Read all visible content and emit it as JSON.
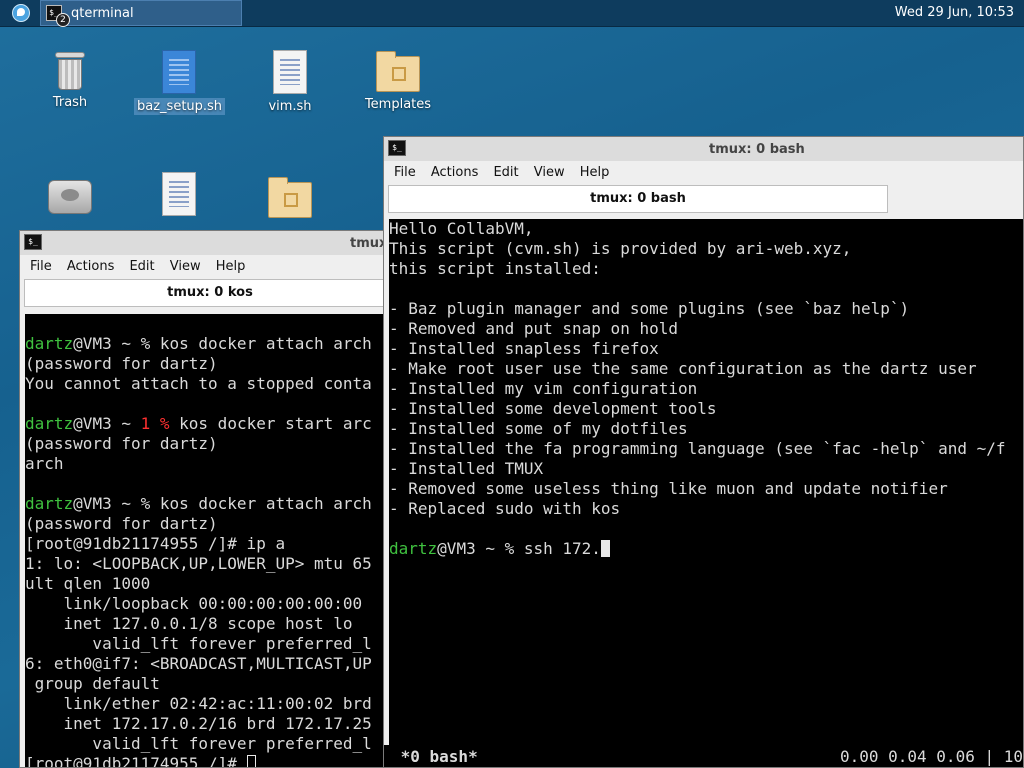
{
  "panel": {
    "task_label": "qterminal",
    "task_badge": "2",
    "clock": "Wed 29 Jun, 10:53"
  },
  "desktop": {
    "icons": [
      {
        "label": "Trash"
      },
      {
        "label": "baz_setup.sh"
      },
      {
        "label": "vim.sh"
      },
      {
        "label": "Templates"
      }
    ]
  },
  "win_left": {
    "title": "tmux",
    "menu": [
      "File",
      "Actions",
      "Edit",
      "View",
      "Help"
    ],
    "tab_label": "tmux: 0 kos",
    "lines": [
      {
        "segments": [
          {
            "t": ""
          }
        ]
      },
      {
        "segments": [
          {
            "t": "dartz",
            "c": "g"
          },
          {
            "t": "@VM3 ~ % kos docker attach arch"
          }
        ]
      },
      {
        "segments": [
          {
            "t": "(password for dartz)"
          }
        ]
      },
      {
        "segments": [
          {
            "t": "You cannot attach to a stopped conta"
          }
        ]
      },
      {
        "segments": [
          {
            "t": ""
          }
        ]
      },
      {
        "segments": [
          {
            "t": "dartz",
            "c": "g"
          },
          {
            "t": "@VM3 ~ "
          },
          {
            "t": "1 %",
            "c": "r"
          },
          {
            "t": " kos docker start arc"
          }
        ]
      },
      {
        "segments": [
          {
            "t": "(password for dartz)"
          }
        ]
      },
      {
        "segments": [
          {
            "t": "arch"
          }
        ]
      },
      {
        "segments": [
          {
            "t": ""
          }
        ]
      },
      {
        "segments": [
          {
            "t": "dartz",
            "c": "g"
          },
          {
            "t": "@VM3 ~ % kos docker attach arch"
          }
        ]
      },
      {
        "segments": [
          {
            "t": "(password for dartz)"
          }
        ]
      },
      {
        "segments": [
          {
            "t": "[root@91db21174955 /]# ip a"
          }
        ]
      },
      {
        "segments": [
          {
            "t": "1: lo: <LOOPBACK,UP,LOWER_UP> mtu 65"
          }
        ]
      },
      {
        "segments": [
          {
            "t": "ult qlen 1000"
          }
        ]
      },
      {
        "segments": [
          {
            "t": "    link/loopback 00:00:00:00:00:00"
          }
        ]
      },
      {
        "segments": [
          {
            "t": "    inet 127.0.0.1/8 scope host lo"
          }
        ]
      },
      {
        "segments": [
          {
            "t": "       valid_lft forever preferred_l"
          }
        ]
      },
      {
        "segments": [
          {
            "t": "6: eth0@if7: <BROADCAST,MULTICAST,UP"
          }
        ]
      },
      {
        "segments": [
          {
            "t": " group default"
          }
        ]
      },
      {
        "segments": [
          {
            "t": "    link/ether 02:42:ac:11:00:02 brd"
          }
        ]
      },
      {
        "segments": [
          {
            "t": "    inet 172.17.0.2/16 brd 172.17.25"
          }
        ]
      },
      {
        "segments": [
          {
            "t": "       valid_lft forever preferred_l"
          }
        ]
      },
      {
        "segments": [
          {
            "t": "[root@91db21174955 /]# "
          }
        ],
        "cursor": "hollow"
      }
    ]
  },
  "win_right": {
    "title": "tmux: 0 bash",
    "menu": [
      "File",
      "Actions",
      "Edit",
      "View",
      "Help"
    ],
    "tab_label": "tmux: 0 bash",
    "lines": [
      {
        "segments": [
          {
            "t": "Hello CollabVM,"
          }
        ]
      },
      {
        "segments": [
          {
            "t": "This script (cvm.sh) is provided by ari-web.xyz,"
          }
        ]
      },
      {
        "segments": [
          {
            "t": "this script installed:"
          }
        ]
      },
      {
        "segments": [
          {
            "t": ""
          }
        ]
      },
      {
        "segments": [
          {
            "t": "- Baz plugin manager and some plugins (see `baz help`)"
          }
        ]
      },
      {
        "segments": [
          {
            "t": "- Removed and put snap on hold"
          }
        ]
      },
      {
        "segments": [
          {
            "t": "- Installed snapless firefox"
          }
        ]
      },
      {
        "segments": [
          {
            "t": "- Make root user use the same configuration as the dartz user"
          }
        ]
      },
      {
        "segments": [
          {
            "t": "- Installed my vim configuration"
          }
        ]
      },
      {
        "segments": [
          {
            "t": "- Installed some development tools"
          }
        ]
      },
      {
        "segments": [
          {
            "t": "- Installed some of my dotfiles"
          }
        ]
      },
      {
        "segments": [
          {
            "t": "- Installed the fa programming language (see `fac -help` and ~/f"
          }
        ]
      },
      {
        "segments": [
          {
            "t": "- Installed TMUX"
          }
        ]
      },
      {
        "segments": [
          {
            "t": "- Removed some useless thing like muon and update notifier"
          }
        ]
      },
      {
        "segments": [
          {
            "t": "- Replaced sudo with kos"
          }
        ]
      },
      {
        "segments": [
          {
            "t": ""
          }
        ]
      },
      {
        "segments": [
          {
            "t": "dartz",
            "c": "g"
          },
          {
            "t": "@VM3 ~ % ssh 172."
          }
        ],
        "cursor": "solid"
      }
    ],
    "status_left": " *0 bash*",
    "status_right": "0.00 0.04 0.06 | 10"
  }
}
